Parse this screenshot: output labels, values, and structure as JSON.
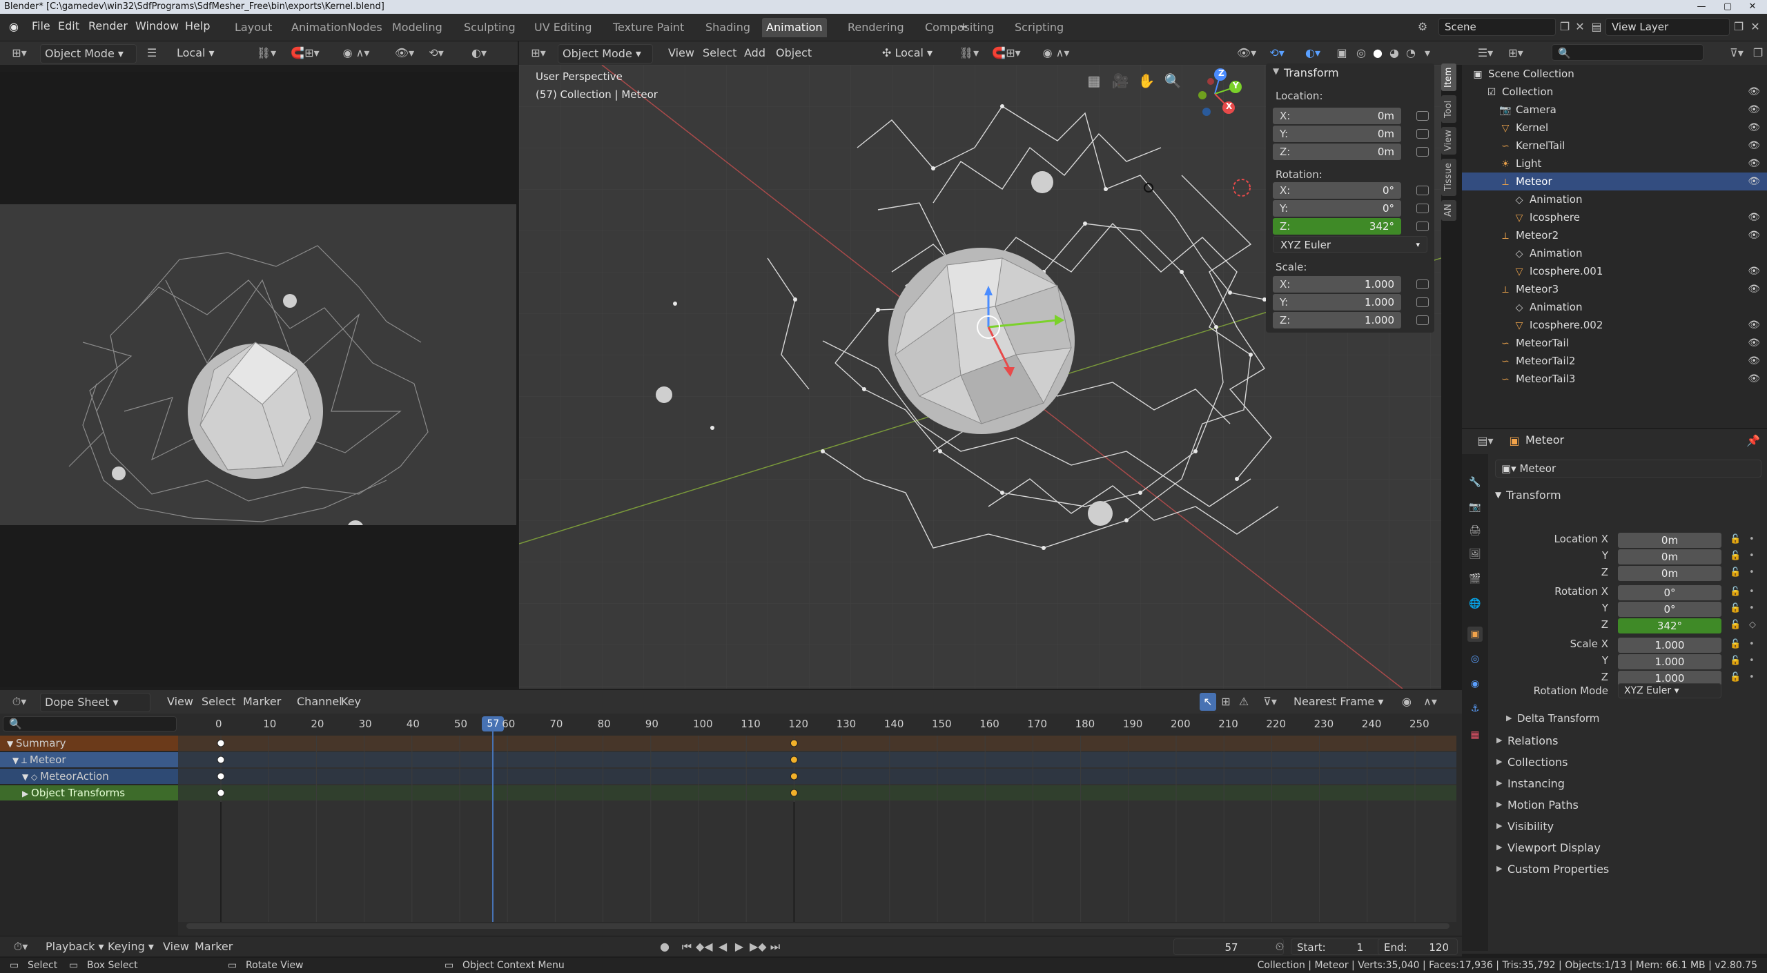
{
  "titlebar": {
    "title": "Blender* [C:\\gamedev\\win32\\SdfPrograms\\SdfMesher_Free\\bin\\exports\\Kernel.blend]"
  },
  "menu": [
    "File",
    "Edit",
    "Render",
    "Window",
    "Help"
  ],
  "workspaces": [
    "Layout",
    "AnimationNodes",
    "Modeling",
    "Sculpting",
    "UV Editing",
    "Texture Paint",
    "Shading",
    "Animation",
    "Rendering",
    "Compositing",
    "Scripting"
  ],
  "active_workspace": "Animation",
  "scene": {
    "name": "Scene",
    "view_layer": "View Layer"
  },
  "left_view": {
    "mode": "Object Mode",
    "orientation": "Local"
  },
  "viewport": {
    "mode": "Object Mode",
    "menus": [
      "View",
      "Select",
      "Add",
      "Object"
    ],
    "orientation": "Local",
    "perspective": "User Perspective",
    "collection_info": "(57) Collection | Meteor",
    "gizmo_axes": [
      "Z",
      "Y",
      "X"
    ]
  },
  "npanel": {
    "title": "Transform",
    "location_label": "Location:",
    "location": [
      {
        "axis": "X:",
        "value": "0m"
      },
      {
        "axis": "Y:",
        "value": "0m"
      },
      {
        "axis": "Z:",
        "value": "0m"
      }
    ],
    "rotation_label": "Rotation:",
    "rotation": [
      {
        "axis": "X:",
        "value": "0°"
      },
      {
        "axis": "Y:",
        "value": "0°"
      },
      {
        "axis": "Z:",
        "value": "342°"
      }
    ],
    "rotation_mode": "XYZ Euler",
    "scale_label": "Scale:",
    "scale": [
      {
        "axis": "X:",
        "value": "1.000"
      },
      {
        "axis": "Y:",
        "value": "1.000"
      },
      {
        "axis": "Z:",
        "value": "1.000"
      }
    ],
    "tabs": [
      "Item",
      "Tool",
      "View",
      "Tissue",
      "AN"
    ]
  },
  "outliner": {
    "root": "Scene Collection",
    "items": [
      {
        "label": "Collection",
        "icon": "collection-icon"
      },
      {
        "label": "Camera",
        "icon": "camera-icon"
      },
      {
        "label": "Kernel",
        "icon": "mesh-icon"
      },
      {
        "label": "KernelTail",
        "icon": "curve-icon"
      },
      {
        "label": "Light",
        "icon": "light-icon"
      },
      {
        "label": "Meteor",
        "icon": "empty-icon"
      },
      {
        "label": "Animation",
        "icon": "action-icon"
      },
      {
        "label": "Icosphere",
        "icon": "mesh-icon"
      },
      {
        "label": "Meteor2",
        "icon": "empty-icon"
      },
      {
        "label": "Animation",
        "icon": "action-icon"
      },
      {
        "label": "Icosphere.001",
        "icon": "mesh-icon"
      },
      {
        "label": "Meteor3",
        "icon": "empty-icon"
      },
      {
        "label": "Animation",
        "icon": "action-icon"
      },
      {
        "label": "Icosphere.002",
        "icon": "mesh-icon"
      },
      {
        "label": "MeteorTail",
        "icon": "curve-icon"
      },
      {
        "label": "MeteorTail2",
        "icon": "curve-icon"
      },
      {
        "label": "MeteorTail3",
        "icon": "curve-icon"
      }
    ]
  },
  "properties": {
    "object_name": "Meteor",
    "name_field": "Meteor",
    "transform_title": "Transform",
    "rows": [
      {
        "label": "Location X",
        "value": "0m"
      },
      {
        "label": "Y",
        "value": "0m"
      },
      {
        "label": "Z",
        "value": "0m"
      },
      {
        "label": "Rotation X",
        "value": "0°"
      },
      {
        "label": "Y",
        "value": "0°"
      },
      {
        "label": "Z",
        "value": "342°"
      },
      {
        "label": "Scale X",
        "value": "1.000"
      },
      {
        "label": "Y",
        "value": "1.000"
      },
      {
        "label": "Z",
        "value": "1.000"
      }
    ],
    "rotation_mode_label": "Rotation Mode",
    "rotation_mode": "XYZ Euler",
    "delta_transform": "Delta Transform",
    "sections": [
      "Relations",
      "Collections",
      "Instancing",
      "Motion Paths",
      "Visibility",
      "Viewport Display",
      "Custom Properties"
    ]
  },
  "dopesheet": {
    "mode": "Dope Sheet",
    "menus": [
      "View",
      "Select",
      "Marker",
      "Channel",
      "Key"
    ],
    "snap": "Nearest Frame",
    "ticks": [
      "0",
      "10",
      "20",
      "30",
      "40",
      "50",
      "60",
      "70",
      "80",
      "90",
      "100",
      "110",
      "120",
      "130",
      "140",
      "150",
      "160",
      "170",
      "180",
      "190",
      "200",
      "210",
      "220",
      "230",
      "240",
      "250"
    ],
    "current_frame": "57",
    "channels": [
      "Summary",
      "Meteor",
      "MeteorAction",
      "Object Transforms"
    ],
    "keyframes": [
      0,
      120
    ]
  },
  "playback": {
    "menus": [
      "Playback",
      "Keying",
      "View",
      "Marker"
    ],
    "frame": "57",
    "start_label": "Start:",
    "start": "1",
    "end_label": "End:",
    "end": "120"
  },
  "status": {
    "select": "Select",
    "box_select": "Box Select",
    "rotate_view": "Rotate View",
    "context_menu": "Object Context Menu",
    "stats": "Collection | Meteor | Verts:35,040 | Faces:17,936 | Tris:35,792 | Objects:1/13 | Mem: 66.1 MB | v2.80.75"
  }
}
